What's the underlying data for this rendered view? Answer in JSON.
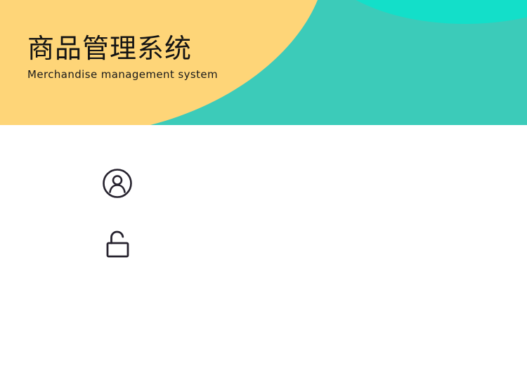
{
  "header": {
    "title": "商品管理系统",
    "subtitle": "Merchandise management system",
    "colors": {
      "yellow": "#fed578",
      "teal": "#3ccbb9",
      "teal_light": "#13dfc9"
    }
  },
  "login_form": {
    "username": {
      "icon": "user-icon",
      "value": "",
      "placeholder": ""
    },
    "password": {
      "icon": "unlock-icon",
      "value": "",
      "placeholder": ""
    }
  }
}
